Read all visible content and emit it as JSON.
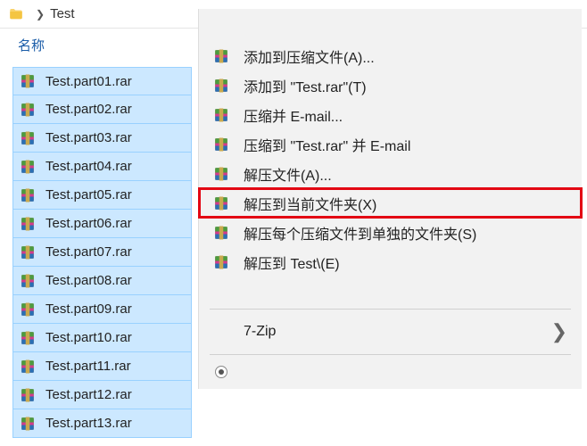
{
  "breadcrumb": {
    "folder": "Test"
  },
  "columns": {
    "name": "名称"
  },
  "files": [
    {
      "name": "Test.part01.rar"
    },
    {
      "name": "Test.part02.rar"
    },
    {
      "name": "Test.part03.rar"
    },
    {
      "name": "Test.part04.rar"
    },
    {
      "name": "Test.part05.rar"
    },
    {
      "name": "Test.part06.rar"
    },
    {
      "name": "Test.part07.rar"
    },
    {
      "name": "Test.part08.rar"
    },
    {
      "name": "Test.part09.rar"
    },
    {
      "name": "Test.part10.rar"
    },
    {
      "name": "Test.part11.rar"
    },
    {
      "name": "Test.part12.rar"
    },
    {
      "name": "Test.part13.rar"
    }
  ],
  "menu": {
    "items": [
      {
        "label": "添加到压缩文件(A)...",
        "highlighted": false
      },
      {
        "label": "添加到 \"Test.rar\"(T)",
        "highlighted": false
      },
      {
        "label": "压缩并 E-mail...",
        "highlighted": false
      },
      {
        "label": "压缩到 \"Test.rar\" 并 E-mail",
        "highlighted": false
      },
      {
        "label": "解压文件(A)...",
        "highlighted": false
      },
      {
        "label": "解压到当前文件夹(X)",
        "highlighted": true
      },
      {
        "label": "解压每个压缩文件到单独的文件夹(S)",
        "highlighted": false
      },
      {
        "label": "解压到 Test\\(E)",
        "highlighted": false
      }
    ],
    "submenu": {
      "label": "7-Zip"
    }
  }
}
